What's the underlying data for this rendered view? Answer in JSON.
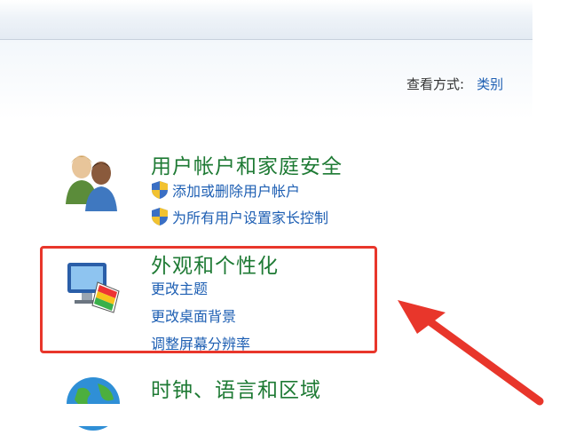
{
  "header": {
    "view_by_label": "查看方式:",
    "view_by_value": "类别"
  },
  "categories": [
    {
      "title": "用户帐户和家庭安全",
      "icon": "users-icon",
      "links": [
        {
          "label": "添加或删除用户帐户",
          "icon": "shield-icon"
        },
        {
          "label": "为所有用户设置家长控制",
          "icon": "shield-icon"
        }
      ]
    },
    {
      "title": "外观和个性化",
      "icon": "monitor-palette-icon",
      "links": [
        {
          "label": "更改主题"
        },
        {
          "label": "更改桌面背景"
        },
        {
          "label": "调整屏幕分辨率"
        }
      ]
    },
    {
      "title": "时钟、语言和区域",
      "icon": "globe-icon",
      "links": []
    }
  ],
  "annotation": {
    "highlight_color": "#e8362b",
    "arrow_color": "#e8362b"
  }
}
